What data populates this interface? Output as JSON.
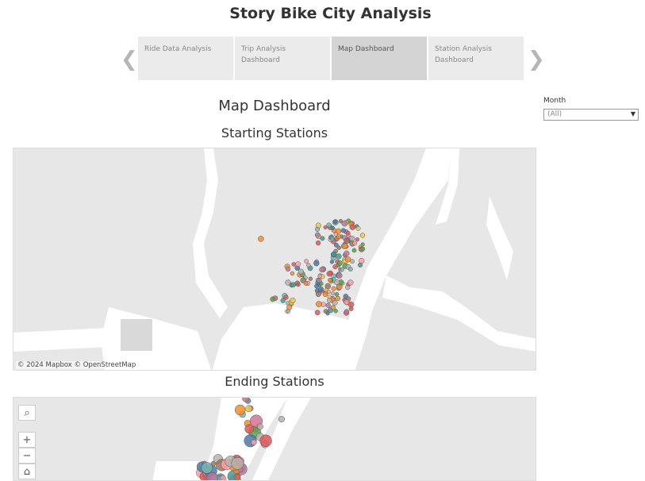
{
  "story": {
    "title": "Story Bike City Analysis"
  },
  "tabs": [
    {
      "label": "Ride Data Analysis",
      "active": false
    },
    {
      "label": "Trip Analysis Dashboard",
      "active": false
    },
    {
      "label": "Map Dashboard",
      "active": true
    },
    {
      "label": "Station Analysis Dashboard",
      "active": false
    }
  ],
  "nav": {
    "prev_icon": "chevron-left-icon",
    "next_icon": "chevron-right-icon",
    "prev_glyph": "❮",
    "next_glyph": "❯"
  },
  "dashboard": {
    "title": "Map Dashboard"
  },
  "filter": {
    "label": "Month",
    "value": "(All)"
  },
  "maps": {
    "starting": {
      "title": "Starting Stations",
      "attribution": "© 2024 Mapbox  © OpenStreetMap"
    },
    "ending": {
      "title": "Ending Stations"
    }
  },
  "map_tools": [
    {
      "name": "search-icon",
      "glyph": "⌕"
    },
    {
      "name": "zoom-in-icon",
      "glyph": "+"
    },
    {
      "name": "zoom-out-icon",
      "glyph": "−"
    },
    {
      "name": "home-icon",
      "glyph": "⌂"
    }
  ],
  "colors": {
    "map_land": "#e7e7e7",
    "map_water": "#ffffff",
    "points": [
      "#4e79a7",
      "#f28e2b",
      "#e15759",
      "#76b7b2",
      "#59a14f",
      "#edc948",
      "#b07aa1",
      "#ff9da7",
      "#9c755f",
      "#bab0ac",
      "#d37295",
      "#499894"
    ]
  }
}
